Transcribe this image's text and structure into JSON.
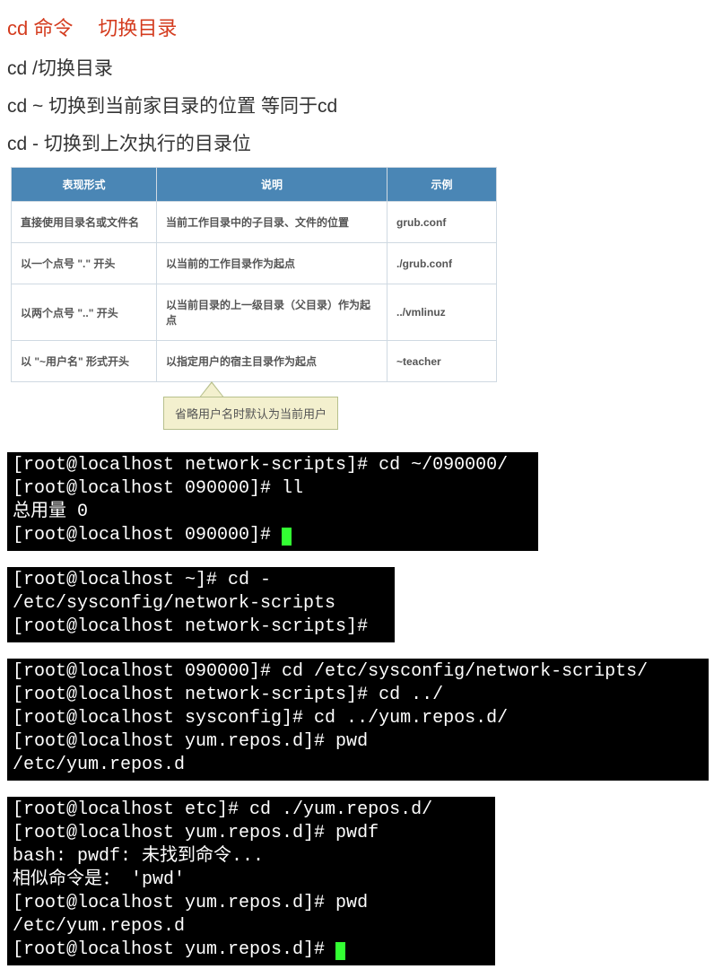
{
  "heading": {
    "part1": "cd 命令",
    "part2": "切换目录"
  },
  "lines": {
    "l1": "cd /切换目录",
    "l2": "cd ~ 切换到当前家目录的位置 等同于cd",
    "l3": "cd - 切换到上次执行的目录位"
  },
  "table": {
    "headers": {
      "form": "表现形式",
      "desc": "说明",
      "example": "示例"
    },
    "rows": [
      {
        "form": "直接使用目录名或文件名",
        "desc": "当前工作目录中的子目录、文件的位置",
        "example": "grub.conf"
      },
      {
        "form": "以一个点号 \".\" 开头",
        "desc": "以当前的工作目录作为起点",
        "example": "./grub.conf"
      },
      {
        "form": "以两个点号 \"..\" 开头",
        "desc": "以当前目录的上一级目录（父目录）作为起点",
        "example": "../vmlinuz"
      },
      {
        "form": "以 \"~用户名\" 形式开头",
        "desc": "以指定用户的宿主目录作为起点",
        "example": "~teacher"
      }
    ]
  },
  "callout": "省略用户名时默认为当前用户",
  "terminals": {
    "t1": "[root@localhost network-scripts]# cd ~/090000/\n[root@localhost 090000]# ll\n总用量 0\n[root@localhost 090000]# ",
    "t2": "[root@localhost ~]# cd -\n/etc/sysconfig/network-scripts\n[root@localhost network-scripts]#",
    "t3": "[root@localhost 090000]# cd /etc/sysconfig/network-scripts/\n[root@localhost network-scripts]# cd ../\n[root@localhost sysconfig]# cd ../yum.repos.d/\n[root@localhost yum.repos.d]# pwd\n/etc/yum.repos.d",
    "t4": "[root@localhost etc]# cd ./yum.repos.d/\n[root@localhost yum.repos.d]# pwdf\nbash: pwdf: 未找到命令...\n相似命令是： 'pwd'\n[root@localhost yum.repos.d]# pwd\n/etc/yum.repos.d\n[root@localhost yum.repos.d]# "
  }
}
